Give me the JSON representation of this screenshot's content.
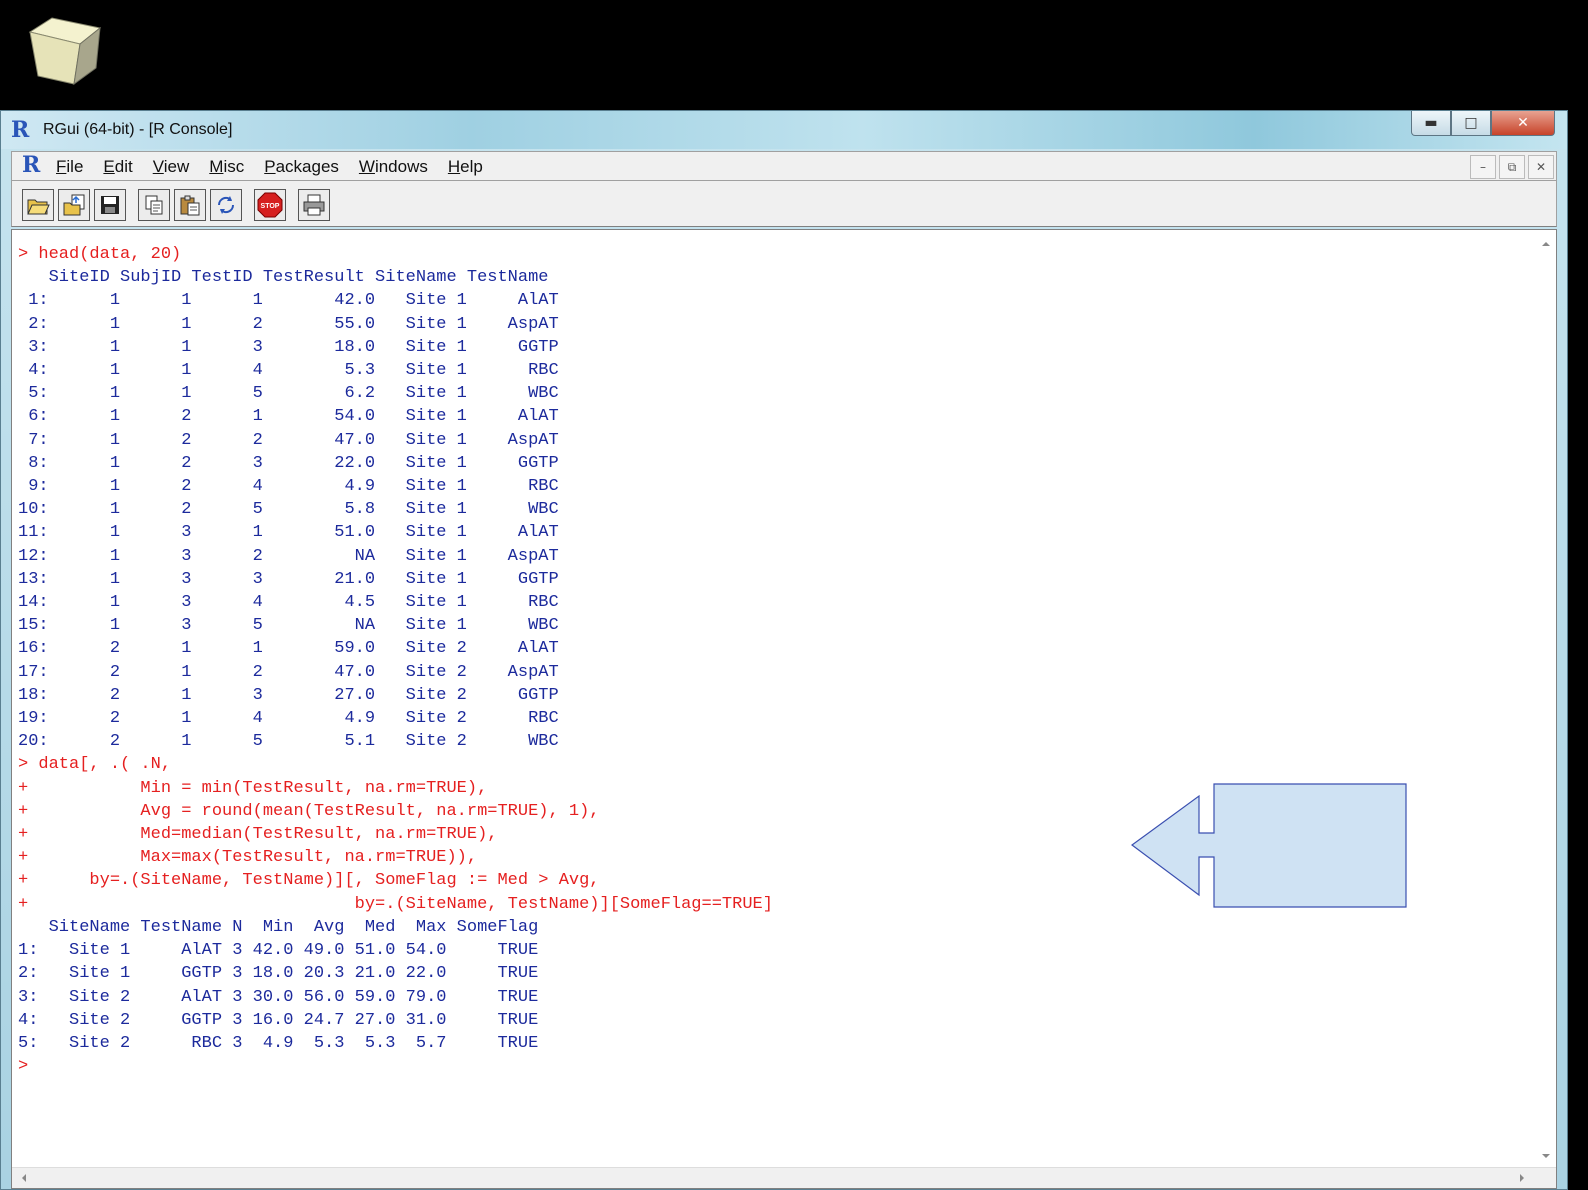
{
  "window": {
    "title": "RGui (64-bit) - [R Console]",
    "logo": "R",
    "controls": [
      "minimize-icon",
      "maximize-icon",
      "close-icon"
    ]
  },
  "menubar": {
    "logo": "R",
    "items": [
      "File",
      "Edit",
      "View",
      "Misc",
      "Packages",
      "Windows",
      "Help"
    ],
    "mdi_controls": [
      "minimize-icon",
      "restore-icon",
      "close-icon"
    ]
  },
  "toolbar": {
    "buttons": [
      {
        "name": "open-script-button",
        "icon": "folder-open-icon"
      },
      {
        "name": "load-workspace-button",
        "icon": "load-icon"
      },
      {
        "name": "save-workspace-button",
        "icon": "floppy-disk-icon"
      },
      {
        "name": "copy-button",
        "icon": "copy-icon"
      },
      {
        "name": "paste-button",
        "icon": "paste-icon"
      },
      {
        "name": "copy-paste-button",
        "icon": "refresh-icon"
      },
      {
        "name": "stop-button",
        "icon": "stop-icon",
        "label": "STOP"
      },
      {
        "name": "print-button",
        "icon": "printer-icon"
      }
    ]
  },
  "console": {
    "lines": [
      {
        "type": "input",
        "text": "> head(data, 20)"
      },
      {
        "type": "output",
        "text": "   SiteID SubjID TestID TestResult SiteName TestName"
      },
      {
        "type": "output",
        "text": " 1:      1      1      1       42.0   Site 1     AlAT"
      },
      {
        "type": "output",
        "text": " 2:      1      1      2       55.0   Site 1    AspAT"
      },
      {
        "type": "output",
        "text": " 3:      1      1      3       18.0   Site 1     GGTP"
      },
      {
        "type": "output",
        "text": " 4:      1      1      4        5.3   Site 1      RBC"
      },
      {
        "type": "output",
        "text": " 5:      1      1      5        6.2   Site 1      WBC"
      },
      {
        "type": "output",
        "text": " 6:      1      2      1       54.0   Site 1     AlAT"
      },
      {
        "type": "output",
        "text": " 7:      1      2      2       47.0   Site 1    AspAT"
      },
      {
        "type": "output",
        "text": " 8:      1      2      3       22.0   Site 1     GGTP"
      },
      {
        "type": "output",
        "text": " 9:      1      2      4        4.9   Site 1      RBC"
      },
      {
        "type": "output",
        "text": "10:      1      2      5        5.8   Site 1      WBC"
      },
      {
        "type": "output",
        "text": "11:      1      3      1       51.0   Site 1     AlAT"
      },
      {
        "type": "output",
        "text": "12:      1      3      2         NA   Site 1    AspAT"
      },
      {
        "type": "output",
        "text": "13:      1      3      3       21.0   Site 1     GGTP"
      },
      {
        "type": "output",
        "text": "14:      1      3      4        4.5   Site 1      RBC"
      },
      {
        "type": "output",
        "text": "15:      1      3      5         NA   Site 1      WBC"
      },
      {
        "type": "output",
        "text": "16:      2      1      1       59.0   Site 2     AlAT"
      },
      {
        "type": "output",
        "text": "17:      2      1      2       47.0   Site 2    AspAT"
      },
      {
        "type": "output",
        "text": "18:      2      1      3       27.0   Site 2     GGTP"
      },
      {
        "type": "output",
        "text": "19:      2      1      4        4.9   Site 2      RBC"
      },
      {
        "type": "output",
        "text": "20:      2      1      5        5.1   Site 2      WBC"
      },
      {
        "type": "input",
        "text": "> data[, .( .N,"
      },
      {
        "type": "input",
        "text": "+           Min = min(TestResult, na.rm=TRUE),"
      },
      {
        "type": "input",
        "text": "+           Avg = round(mean(TestResult, na.rm=TRUE), 1),"
      },
      {
        "type": "input",
        "text": "+           Med=median(TestResult, na.rm=TRUE),"
      },
      {
        "type": "input",
        "text": "+           Max=max(TestResult, na.rm=TRUE)),"
      },
      {
        "type": "input",
        "text": "+      by=.(SiteName, TestName)][, SomeFlag := Med > Avg,"
      },
      {
        "type": "input",
        "text": "+                                by=.(SiteName, TestName)][SomeFlag==TRUE]"
      },
      {
        "type": "output",
        "text": "   SiteName TestName N  Min  Avg  Med  Max SomeFlag"
      },
      {
        "type": "output",
        "text": "1:   Site 1     AlAT 3 42.0 49.0 51.0 54.0     TRUE"
      },
      {
        "type": "output",
        "text": "2:   Site 1     GGTP 3 18.0 20.3 21.0 22.0     TRUE"
      },
      {
        "type": "output",
        "text": "3:   Site 2     AlAT 3 30.0 56.0 59.0 79.0     TRUE"
      },
      {
        "type": "output",
        "text": "4:   Site 2     GGTP 3 16.0 24.7 27.0 31.0     TRUE"
      },
      {
        "type": "output",
        "text": "5:   Site 2      RBC 3  4.9  5.3  5.3  5.7     TRUE"
      },
      {
        "type": "input",
        "text": ">"
      }
    ]
  },
  "colors": {
    "input_text": "#e52020",
    "output_text": "#1c2a9c",
    "callout_fill": "#cfe2f3",
    "callout_stroke": "#3a4fb0"
  }
}
